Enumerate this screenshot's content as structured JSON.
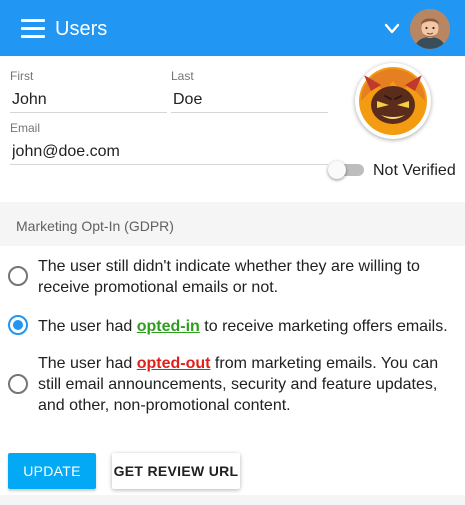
{
  "appbar": {
    "title": "Users",
    "menu_icon": "hamburger-menu-icon",
    "dropdown_icon": "chevron-down-icon",
    "background": "#2196f3"
  },
  "form": {
    "first": {
      "label": "First",
      "value": "John"
    },
    "last": {
      "label": "Last",
      "value": "Doe"
    },
    "email": {
      "label": "Email",
      "value": "john@doe.com"
    }
  },
  "verification": {
    "label": "Not Verified",
    "checked": false
  },
  "marketing": {
    "title": "Marketing Opt-In (GDPR)",
    "options": [
      {
        "text": "The user still didn't indicate whether they are willing to receive promotional emails or not.",
        "selected": false
      },
      {
        "before": "The user had ",
        "highlight": "opted-in",
        "after": " to receive marketing offers emails.",
        "selected": true
      },
      {
        "before": "The user had ",
        "highlight": "opted-out",
        "after": " from marketing emails. You can still email announcements, security and feature updates, and other, non-promotional content.",
        "selected": false
      }
    ]
  },
  "actions": {
    "update": "UPDATE",
    "review_url": "GET REVIEW URL"
  },
  "colors": {
    "accent": "#2196f3",
    "primary_button": "#03a9f4",
    "opted_in": "#2e9e1f",
    "opted_out": "#e0201b"
  }
}
